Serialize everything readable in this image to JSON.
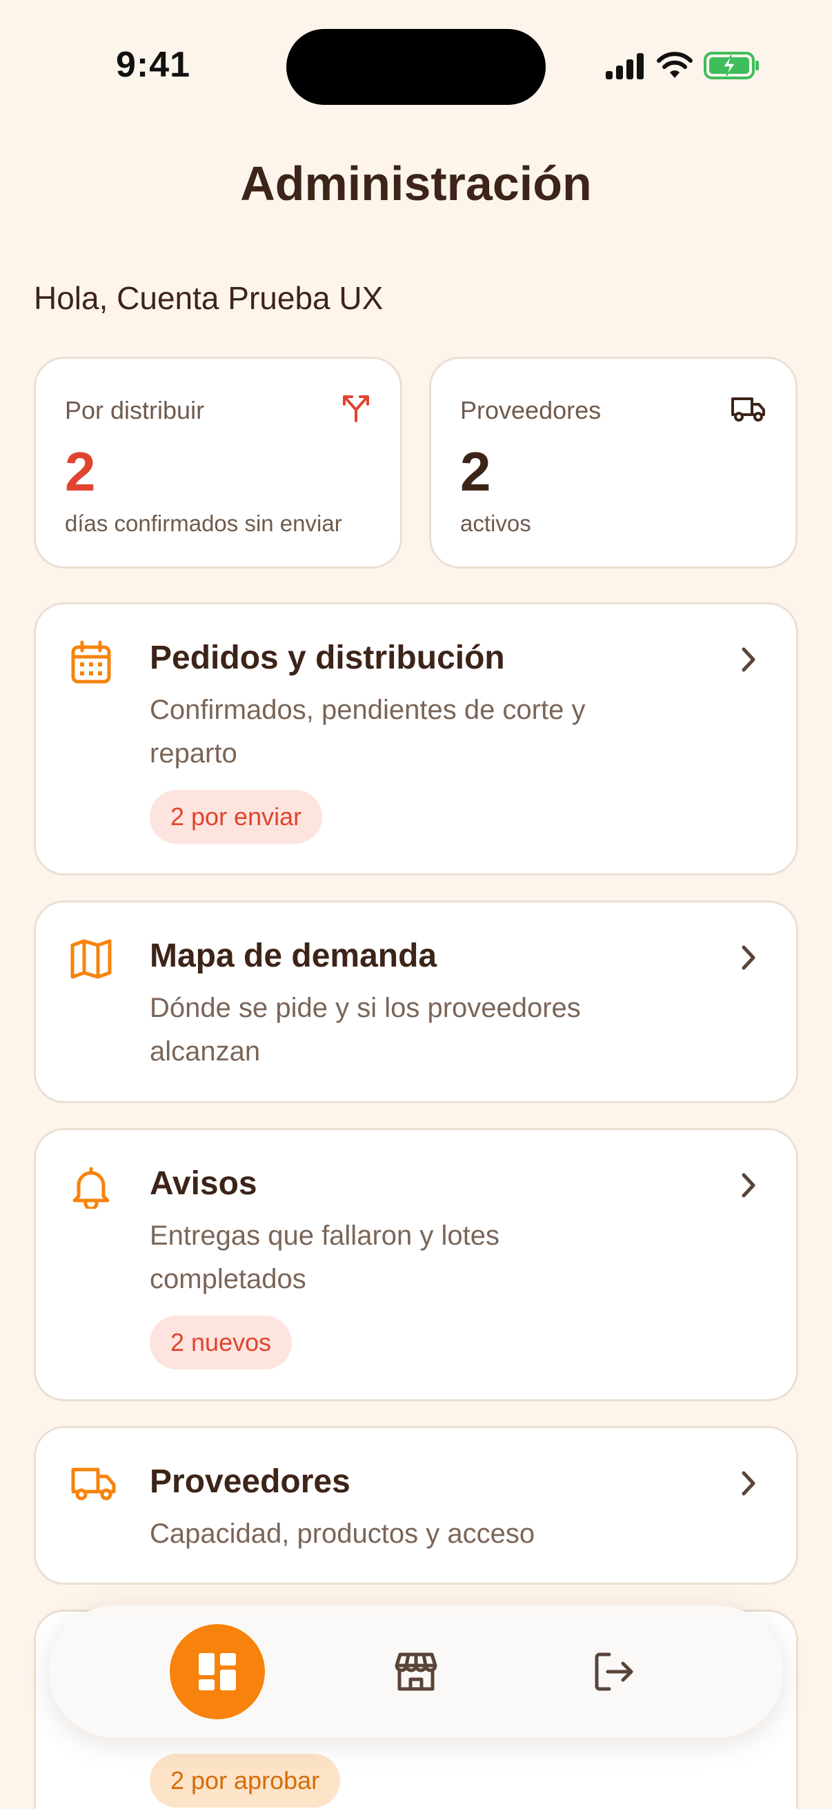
{
  "status_bar": {
    "time": "9:41"
  },
  "header": {
    "title": "Administración",
    "greeting": "Hola, Cuenta Prueba UX"
  },
  "stats": [
    {
      "label": "Por distribuir",
      "value": "2",
      "sub": "días confirmados sin enviar",
      "icon": "split-arrows-icon",
      "value_color": "#e0442e"
    },
    {
      "label": "Proveedores",
      "value": "2",
      "sub": "activos",
      "icon": "truck-icon",
      "value_color": "#3d2418"
    }
  ],
  "menu": [
    {
      "title": "Pedidos y distribución",
      "desc_line1": "Confirmados, pendientes de corte y",
      "desc_line2": "reparto",
      "badge": "2 por enviar",
      "icon": "calendar-icon"
    },
    {
      "title": "Mapa de demanda",
      "desc_line1": "Dónde se pide y si los proveedores",
      "desc_line2": "alcanzan",
      "icon": "map-icon"
    },
    {
      "title": "Avisos",
      "desc_line1": "Entregas que fallaron y lotes",
      "desc_line2": "completados",
      "badge": "2 nuevos",
      "icon": "bell-icon"
    },
    {
      "title": "Proveedores",
      "desc_line1": "Capacidad, productos y acceso",
      "icon": "truck-icon"
    },
    {
      "badge": "2 por aprobar"
    }
  ],
  "nav": {
    "items": [
      {
        "name": "dashboard",
        "icon": "dashboard-icon",
        "active": true
      },
      {
        "name": "store",
        "icon": "store-icon",
        "active": false
      },
      {
        "name": "logout",
        "icon": "logout-icon",
        "active": false
      }
    ]
  },
  "colors": {
    "accent": "#f7830c",
    "background": "#fdf5ec",
    "text": "#3d2418",
    "danger": "#e0442e"
  }
}
